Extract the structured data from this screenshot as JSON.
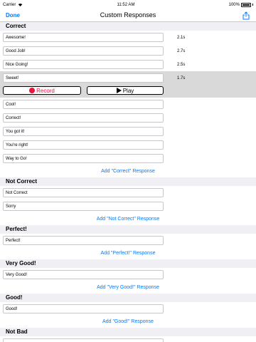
{
  "status": {
    "carrier": "Carrier",
    "time": "11:52 AM",
    "battery": "100%",
    "battery_level": 1.0
  },
  "nav": {
    "back_label": "Done",
    "title": "Custom Responses",
    "share_icon": "share-icon"
  },
  "sections": [
    {
      "header": "Correct",
      "add_label": "Add \"Correct\" Response",
      "items": [
        {
          "text": "Awesome!",
          "duration": "2.1s"
        },
        {
          "text": "Good Job!",
          "duration": "2.7s"
        },
        {
          "text": "Nice Going!",
          "duration": "2.5s"
        },
        {
          "text": "Sweet!",
          "duration": "1.7s",
          "selected": true
        },
        {
          "text": "Cool!"
        },
        {
          "text": "Correct!"
        },
        {
          "text": "You got it!"
        },
        {
          "text": "You're right!"
        },
        {
          "text": "Way to Go!"
        }
      ]
    },
    {
      "header": "Not Correct",
      "add_label": "Add \"Not Correct\" Response",
      "items": [
        {
          "text": "Not Correct"
        },
        {
          "text": "Sorry"
        }
      ]
    },
    {
      "header": "Perfect!",
      "add_label": "Add \"Perfect!\" Response",
      "items": [
        {
          "text": "Perfect!"
        }
      ]
    },
    {
      "header": "Very Good!",
      "add_label": "Add \"Very Good!\" Response",
      "items": [
        {
          "text": "Very Good!"
        }
      ]
    },
    {
      "header": "Good!",
      "add_label": "Add \"Good!\" Response",
      "items": [
        {
          "text": "Good!"
        }
      ]
    },
    {
      "header": "Not Bad",
      "add_label": "",
      "items": [
        {
          "text": ""
        }
      ]
    }
  ],
  "controls": {
    "record_label": "Record",
    "play_label": "Play"
  },
  "colors": {
    "accent": "#007aff",
    "record": "#e8153c",
    "header_bg": "#efeff4",
    "selected_bg": "#d9d9d9"
  }
}
